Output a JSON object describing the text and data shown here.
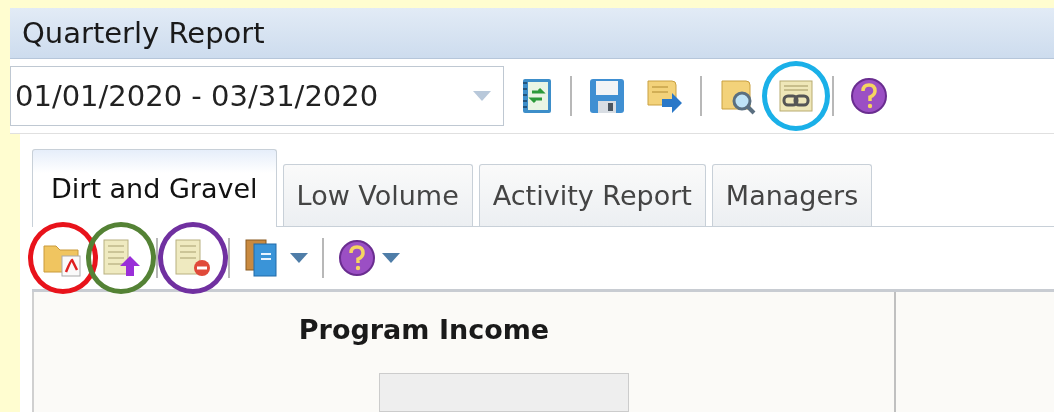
{
  "window": {
    "title": "Quarterly Report"
  },
  "toolbar": {
    "date_range": "01/01/2020 - 03/31/2020",
    "buttons": [
      {
        "kind": "ledger"
      },
      {
        "kind": "separator"
      },
      {
        "kind": "save"
      },
      {
        "kind": "export"
      },
      {
        "kind": "separator"
      },
      {
        "kind": "preview"
      },
      {
        "kind": "link",
        "color": "#1ab0e8"
      },
      {
        "kind": "separator"
      },
      {
        "kind": "help"
      }
    ]
  },
  "tabs": [
    {
      "label": "Dirt and Gravel",
      "selected": true
    },
    {
      "label": "Low Volume",
      "selected": false
    },
    {
      "label": "Activity Report",
      "selected": false
    },
    {
      "label": "Managers",
      "selected": false
    }
  ],
  "tab_toolbar": {
    "buttons": [
      {
        "kind": "pdf",
        "color": "#e8131b"
      },
      {
        "kind": "upload",
        "color": "#548235"
      },
      {
        "kind": "separator"
      },
      {
        "kind": "remove",
        "color": "#7030a0"
      },
      {
        "kind": "separator"
      },
      {
        "kind": "books",
        "dropdown": true
      },
      {
        "kind": "separator"
      },
      {
        "kind": "help",
        "dropdown": true
      }
    ]
  },
  "panel": {
    "heading": "Program Income"
  }
}
